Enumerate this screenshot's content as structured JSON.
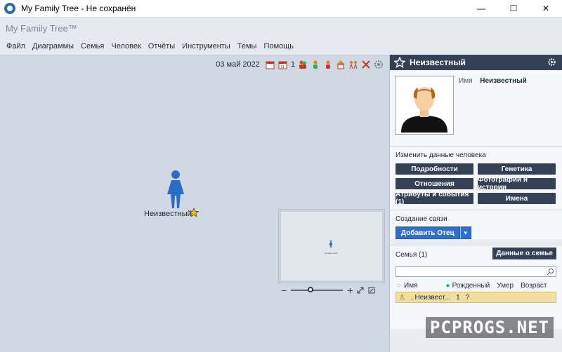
{
  "window": {
    "title": "My Family Tree - Не сохранён",
    "minimize": "—",
    "maximize": "☐",
    "close": "✕"
  },
  "header": {
    "app_name": "My Family Tree™"
  },
  "menu": [
    "Файл",
    "Диаграммы",
    "Семья",
    "Человек",
    "Отчёты",
    "Инструменты",
    "Темы",
    "Помощь"
  ],
  "toolbar": {
    "date": "03 май 2022",
    "generations": "1"
  },
  "canvas": {
    "person_name": "Неизвестный",
    "minimap_label": "Неизвестный"
  },
  "panel": {
    "title": "Неизвестный",
    "name_label": "Имя",
    "name_value": "Неизвестный",
    "edit_section": "Изменить данные человека",
    "edit_buttons": [
      "Подробности",
      "Генетика",
      "Отношения",
      "Фотографии и истории",
      "Атрибуты и события (1)",
      "Имена"
    ],
    "link_section": "Создание связи",
    "add_father": "Добавить Отец",
    "family_section": "Семья (1)",
    "family_data_button": "Данные о семье",
    "columns": [
      "Имя",
      "Рожденный",
      "Умер",
      "Возраст"
    ],
    "family_row": {
      "name": ", Неизвест...",
      "born": "1",
      "died": "?"
    }
  },
  "watermark": "PCPROGS.NET",
  "colors": {
    "accent": "#2f6fce",
    "dark_button": "#334055",
    "selected_row": "#f1dfa1",
    "person_blue": "#2b6cc4"
  }
}
